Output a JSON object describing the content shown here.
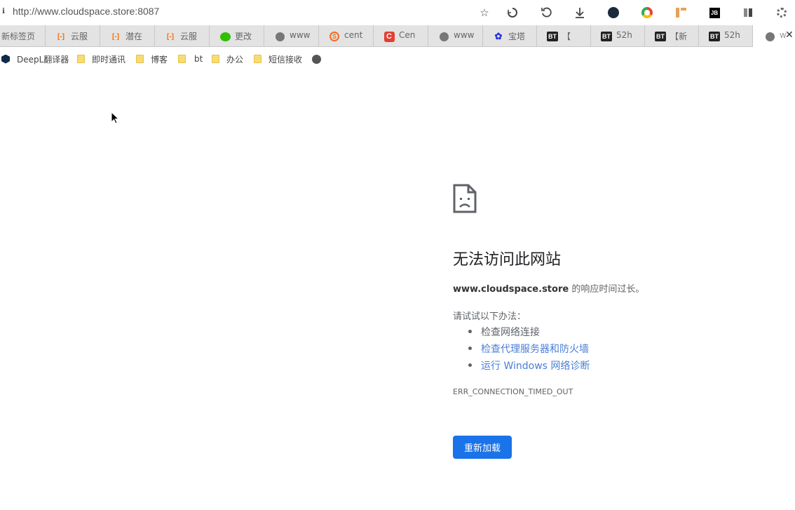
{
  "address_bar": {
    "url": "http://www.cloudspace.store:8087"
  },
  "toolbar_icons": [
    "star-icon",
    "sync-icon",
    "reload-icon",
    "download-icon",
    "extension-dark-icon",
    "chrome-color-icon",
    "extension-orange-icon",
    "jetbrains-icon",
    "sidebar-icon",
    "settings-icon"
  ],
  "tabs": [
    {
      "label": "新标签页",
      "icon": ""
    },
    {
      "label": "云服",
      "icon": "aliyun-icon"
    },
    {
      "label": "潜在",
      "icon": "aliyun-icon"
    },
    {
      "label": "云服",
      "icon": "aliyun-icon"
    },
    {
      "label": "更改",
      "icon": "wechat-icon"
    },
    {
      "label": "www",
      "icon": "globe-icon"
    },
    {
      "label": "cent",
      "icon": "sogou-icon"
    },
    {
      "label": "Cen",
      "icon": "csdn-icon"
    },
    {
      "label": "www",
      "icon": "globe-icon"
    },
    {
      "label": "宝塔",
      "icon": "baidu-paw-icon"
    },
    {
      "label": "【",
      "icon": "bt-icon"
    },
    {
      "label": "52h",
      "icon": "bt-icon"
    },
    {
      "label": "【新",
      "icon": "bt-icon"
    },
    {
      "label": "52h",
      "icon": "bt-icon"
    },
    {
      "label": "w",
      "icon": "globe-icon"
    }
  ],
  "bookmarks": [
    {
      "label": "DeepL翻译器",
      "icon": "deepl-icon"
    },
    {
      "label": "即时通讯",
      "icon": "folder-icon"
    },
    {
      "label": "博客",
      "icon": "folder-icon"
    },
    {
      "label": "bt",
      "icon": "folder-icon"
    },
    {
      "label": "办公",
      "icon": "folder-icon"
    },
    {
      "label": "短信接收",
      "icon": "folder-icon"
    },
    {
      "label": "",
      "icon": "globe-icon"
    }
  ],
  "error": {
    "title": "无法访问此网站",
    "host": "www.cloudspace.store",
    "desc_suffix": " 的响应时间过长。",
    "try_label": "请试试以下办法：",
    "suggestions": [
      {
        "text": "检查网络连接",
        "link": false
      },
      {
        "text": "检查代理服务器和防火墙",
        "link": true
      },
      {
        "text": "运行 Windows 网络诊断",
        "link": true
      }
    ],
    "code": "ERR_CONNECTION_TIMED_OUT",
    "reload_label": "重新加载"
  },
  "colors": {
    "link": "#4a7fd6",
    "button": "#1a73e8",
    "tab_bg": "#e3e3e3"
  }
}
